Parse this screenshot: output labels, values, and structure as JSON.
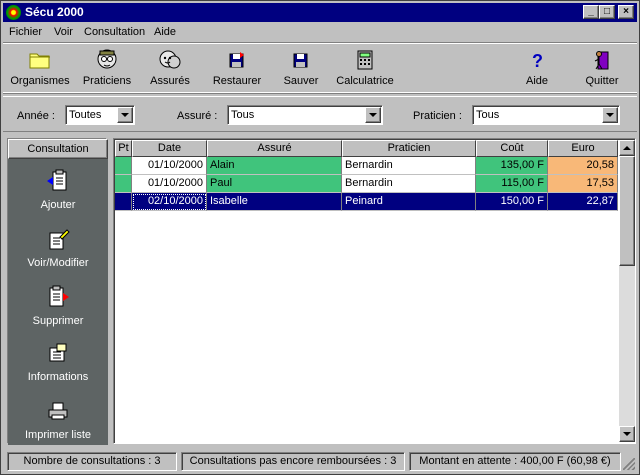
{
  "window": {
    "title": "Sécu 2000"
  },
  "titlebar_buttons": {
    "minimize": "_",
    "maximize": "□",
    "close": "×"
  },
  "menubar": [
    {
      "label": "Fichier"
    },
    {
      "label": "Voir"
    },
    {
      "label": "Consultation"
    },
    {
      "label": "Aide"
    }
  ],
  "toolbar": [
    {
      "label": "Organismes",
      "icon": "folder-icon"
    },
    {
      "label": "Praticiens",
      "icon": "doctor-icon"
    },
    {
      "label": "Assurés",
      "icon": "people-icon"
    },
    {
      "label": "Restaurer",
      "icon": "restore-disk-icon"
    },
    {
      "label": "Sauver",
      "icon": "save-disk-icon"
    },
    {
      "label": "Calculatrice",
      "icon": "calculator-icon"
    },
    {
      "label": "Aide",
      "icon": "help-icon"
    },
    {
      "label": "Quitter",
      "icon": "exit-door-icon"
    }
  ],
  "filters": {
    "annee": {
      "label": "Année :",
      "value": "Toutes"
    },
    "assure": {
      "label": "Assuré :",
      "value": "Tous"
    },
    "praticien": {
      "label": "Praticien :",
      "value": "Tous"
    }
  },
  "sidepanel": {
    "header": "Consultation",
    "items": [
      {
        "label": "Ajouter",
        "icon": "add-document-icon"
      },
      {
        "label": "Voir/Modifier",
        "icon": "edit-document-icon"
      },
      {
        "label": "Supprimer",
        "icon": "delete-document-icon"
      },
      {
        "label": "Informations",
        "icon": "info-document-icon"
      },
      {
        "label": "Imprimer liste",
        "icon": "printer-icon"
      }
    ]
  },
  "grid": {
    "columns": [
      "Pt",
      "Date",
      "Assuré",
      "Praticien",
      "Coût",
      "Euro"
    ],
    "rows": [
      {
        "pt": "",
        "date": "01/10/2000",
        "assure": "Alain",
        "praticien": "Bernardin",
        "cout": "135,00 F",
        "euro": "20,58",
        "selected": false
      },
      {
        "pt": "",
        "date": "01/10/2000",
        "assure": "Paul",
        "praticien": "Bernardin",
        "cout": "115,00 F",
        "euro": "17,53",
        "selected": false
      },
      {
        "pt": "",
        "date": "02/10/2000",
        "assure": "Isabelle",
        "praticien": "Peinard",
        "cout": "150,00 F",
        "euro": "22,87",
        "selected": true
      }
    ]
  },
  "statusbar": {
    "count": "Nombre de consultations : 3",
    "unpaid": "Consultations pas encore remboursées : 3",
    "pending": "Montant en attente : 400,00 F (60,98 €)"
  },
  "colors": {
    "titlebar": "#000080",
    "green": "#40c47c",
    "orange": "#f8b878",
    "selection": "#000080",
    "sidepanel": "#5e6464"
  }
}
